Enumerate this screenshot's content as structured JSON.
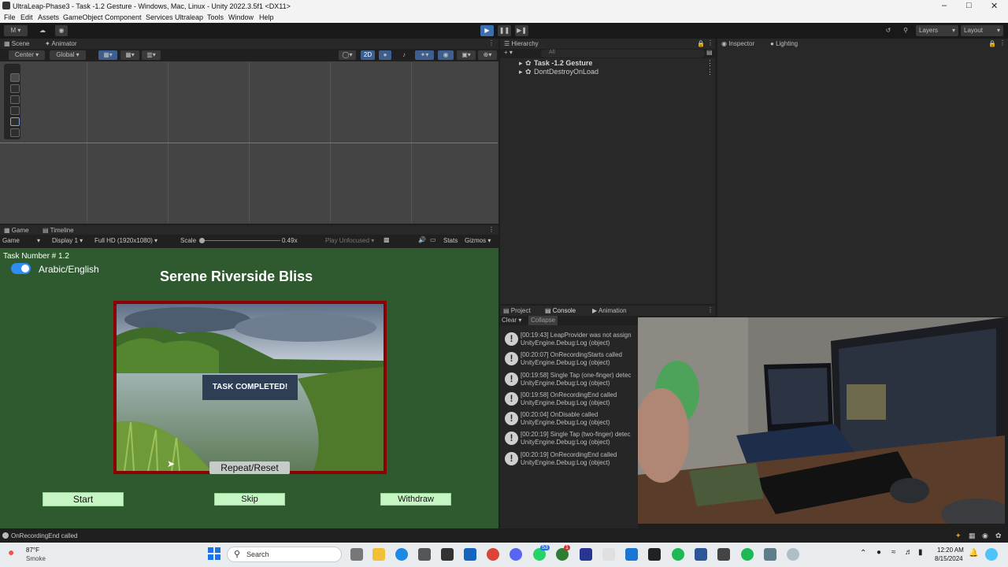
{
  "window": {
    "title": "UltraLeap-Phase3 - Task -1.2 Gesture - Windows, Mac, Linux - Unity 2022.3.5f1 <DX11>"
  },
  "menu": [
    "File",
    "Edit",
    "Assets",
    "GameObject",
    "Component",
    "Services",
    "Ultraleap",
    "Tools",
    "Window",
    "Help"
  ],
  "toolbar": {
    "account": "M",
    "layers": "Layers",
    "layout": "Layout"
  },
  "scene_panel": {
    "tabs": [
      "Scene",
      "Animator"
    ],
    "pivot": "Center",
    "space": "Global",
    "mode2d": "2D"
  },
  "hierarchy": {
    "tab": "Hierarchy",
    "search_placeholder": "All",
    "items": [
      "Task -1.2 Gesture",
      "DontDestroyOnLoad"
    ]
  },
  "inspector": {
    "tabs": [
      "Inspector",
      "Lighting"
    ]
  },
  "game_panel": {
    "tabs": [
      "Game",
      "Timeline"
    ],
    "mode": "Game",
    "display": "Display 1",
    "resolution": "Full HD (1920x1080)",
    "scale_label": "Scale",
    "scale_value": "0.49x",
    "play_focus": "Play Unfocused",
    "stats": "Stats",
    "gizmos": "Gizmos"
  },
  "game": {
    "task_number": "Task Number # 1.2",
    "toggle_label": "Arabic/English",
    "title": "Serene Riverside Bliss",
    "completed": "TASK COMPLETED!",
    "repeat": "Repeat/Reset",
    "start": "Start",
    "skip": "Skip",
    "withdraw": "Withdraw"
  },
  "bottom_panel": {
    "tabs": [
      "Project",
      "Console",
      "Animation"
    ],
    "clear": "Clear",
    "collapse": "Collapse"
  },
  "console": [
    {
      "l1": "[00:19:43] LeapProvider was not assign",
      "l2": "UnityEngine.Debug:Log (object)"
    },
    {
      "l1": "[00:20:07] OnRecordingStarts called",
      "l2": "UnityEngine.Debug:Log (object)"
    },
    {
      "l1": "[00:19:58] Single Tap (one-finger) detec",
      "l2": "UnityEngine.Debug:Log (object)"
    },
    {
      "l1": "[00:19:58] OnRecordingEnd called",
      "l2": "UnityEngine.Debug:Log (object)"
    },
    {
      "l1": "[00:20:04] OnDisable called",
      "l2": "UnityEngine.Debug:Log (object)"
    },
    {
      "l1": "[00:20:19] Single Tap (two-finger) detec",
      "l2": "UnityEngine.Debug:Log (object)"
    },
    {
      "l1": "[00:20:19] OnRecordingEnd called",
      "l2": "UnityEngine.Debug:Log (object)"
    }
  ],
  "status": {
    "text": "OnRecordingEnd called"
  },
  "taskbar": {
    "weather_temp": "87°F",
    "weather_desc": "Smoke",
    "search": "Search",
    "time": "12:20 AM",
    "date": "8/15/2024",
    "badge1": "53",
    "badge2": "1"
  },
  "colors": {
    "game_bg": "#2f5a30",
    "button_green": "#c4f5c2",
    "frame_red": "#8b0000",
    "toggle_blue": "#2f8cf0"
  }
}
